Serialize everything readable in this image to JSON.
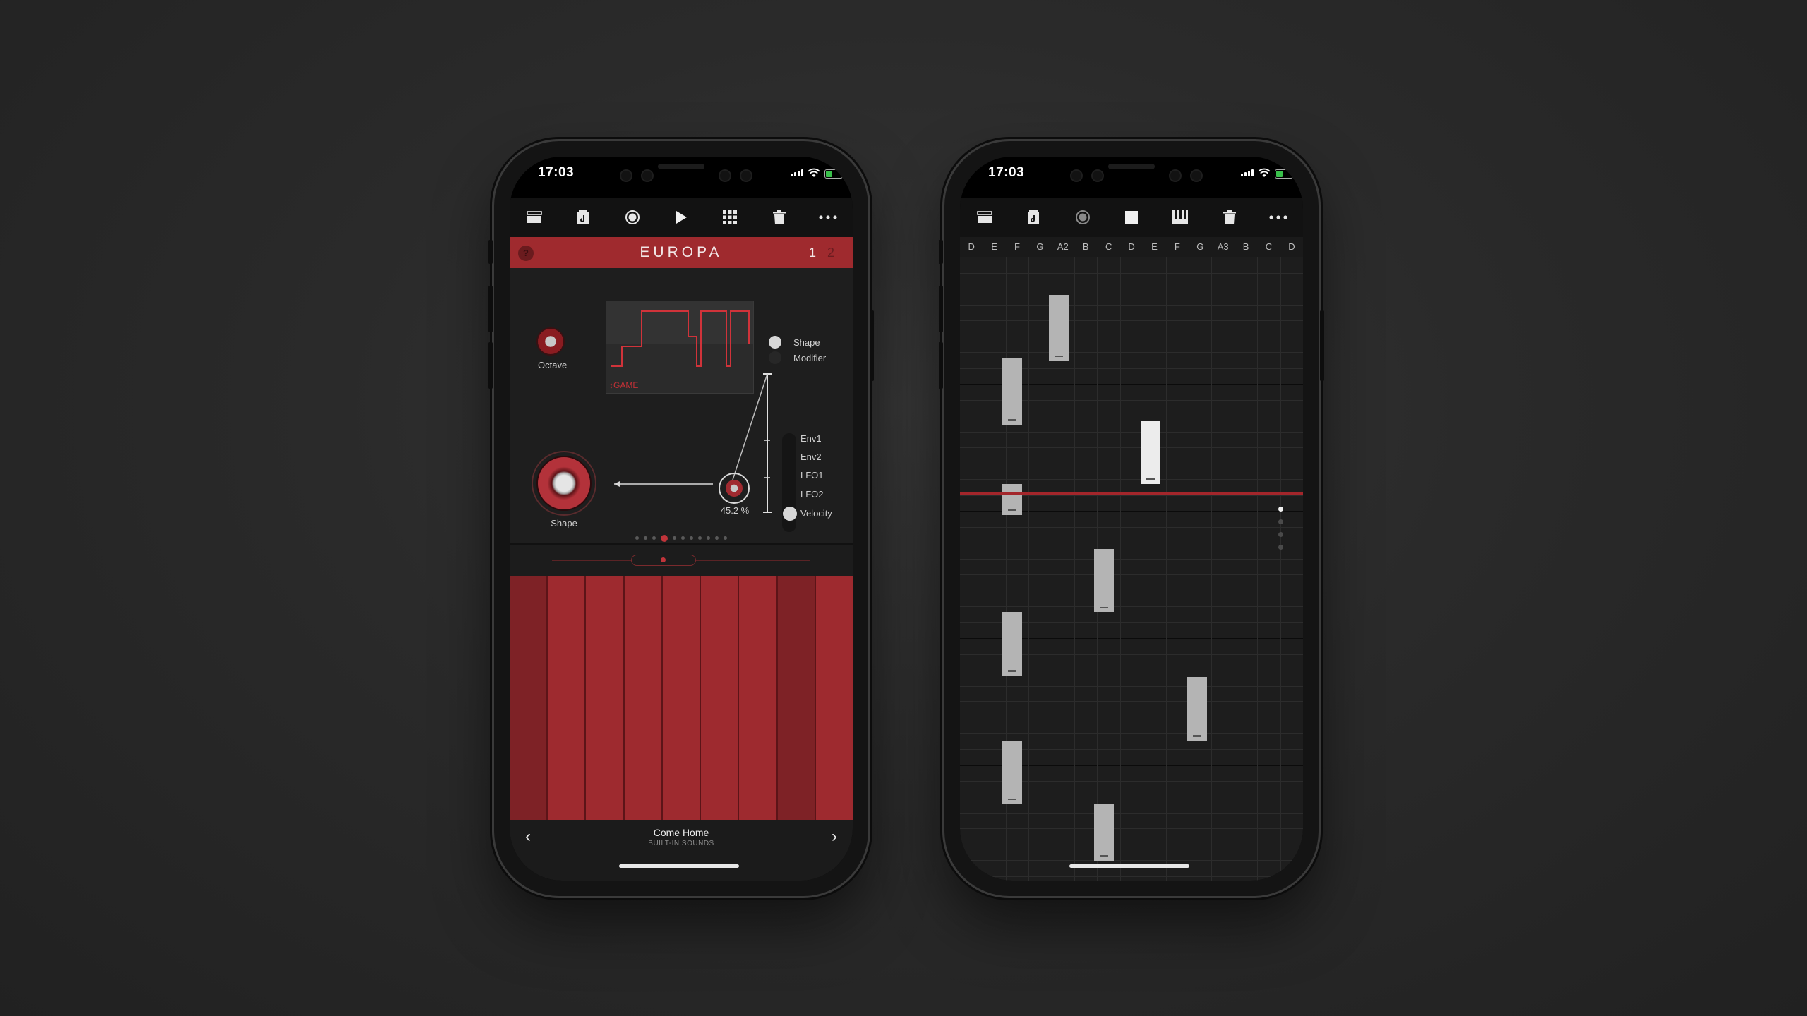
{
  "left_phone": {
    "status": {
      "time": "17:03"
    },
    "toolbar": [
      {
        "name": "browser-icon"
      },
      {
        "name": "song-icon"
      },
      {
        "name": "record-icon"
      },
      {
        "name": "play-icon"
      },
      {
        "name": "grid-icon"
      },
      {
        "name": "trash-icon"
      },
      {
        "name": "more-icon"
      }
    ],
    "titlebar": {
      "title": "EUROPA",
      "help": "?",
      "page1": "1",
      "page2": "2"
    },
    "synth": {
      "octave_label": "Octave",
      "shape_label": "Shape",
      "scope_preset": "↕GAME",
      "mod_value": "45.2 %",
      "toggles": [
        "Shape",
        "Modifier"
      ],
      "sources": [
        "Env1",
        "Env2",
        "LFO1",
        "LFO2",
        "Velocity"
      ],
      "page_dots": 11,
      "active_dot": 3
    },
    "pads": {
      "count": 9
    },
    "bottom": {
      "song": "Come Home",
      "source": "BUILT-IN SOUNDS",
      "prev": "‹",
      "next": "›"
    }
  },
  "right_phone": {
    "status": {
      "time": "17:03"
    },
    "toolbar": [
      {
        "name": "browser-icon"
      },
      {
        "name": "song-icon"
      },
      {
        "name": "record-icon"
      },
      {
        "name": "stop-icon"
      },
      {
        "name": "keyboard-icon"
      },
      {
        "name": "trash-icon"
      },
      {
        "name": "more-icon"
      }
    ],
    "note_names": [
      "D",
      "E",
      "F",
      "G",
      "A2",
      "B",
      "C",
      "D",
      "E",
      "F",
      "G",
      "A3",
      "B",
      "C",
      "D"
    ],
    "page_dots": 4,
    "active_dot": 0
  },
  "colors": {
    "accent": "#9f2a2e",
    "background": "#262626",
    "note": "#b4b4b4"
  }
}
